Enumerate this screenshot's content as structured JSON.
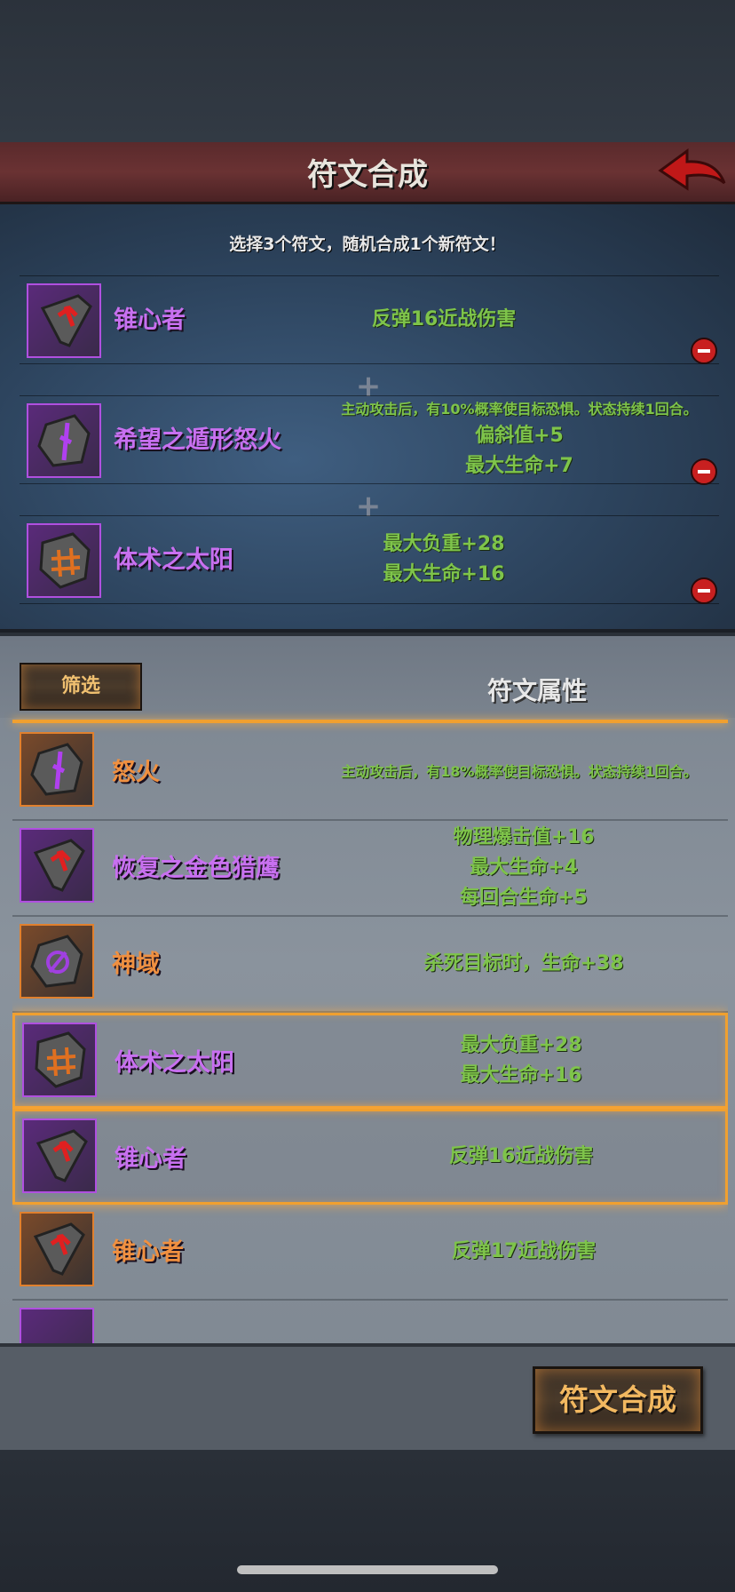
{
  "header": {
    "title": "符文合成",
    "back_icon": "back-arrow-icon"
  },
  "compose": {
    "subtitle": "选择3个符文，随机合成1个新符文！",
    "slots": [
      {
        "name": "锥心者",
        "attrs": [
          "反弹16近战伤害"
        ],
        "icon": "rune-heart-piercer-icon"
      },
      {
        "name": "希望之遁形怒火",
        "attrs": [
          "主动攻击后，有10%概率使目标恐惧。状态持续1回合。",
          "偏斜值+5",
          "最大生命+7"
        ],
        "icon": "rune-fury-icon"
      },
      {
        "name": "体术之太阳",
        "attrs": [
          "最大负重+28",
          "最大生命+16"
        ],
        "icon": "rune-sun-icon"
      }
    ]
  },
  "list": {
    "filter_label": "筛选",
    "title": "符文属性",
    "rows": [
      {
        "name": "怒火",
        "attrs": [
          "主动攻击后，有18%概率使目标恐惧。状态持续1回合。"
        ],
        "color": "orange",
        "selected": false
      },
      {
        "name": "恢复之金色猎鹰",
        "attrs": [
          "物理爆击值+16",
          "最大生命+4",
          "每回合生命+5"
        ],
        "color": "purple",
        "selected": false
      },
      {
        "name": "神域",
        "attrs": [
          "杀死目标时，生命+38"
        ],
        "color": "orange",
        "selected": false
      },
      {
        "name": "体术之太阳",
        "attrs": [
          "最大负重+28",
          "最大生命+16"
        ],
        "color": "purple",
        "selected": true
      },
      {
        "name": "锥心者",
        "attrs": [
          "反弹16近战伤害"
        ],
        "color": "purple",
        "selected": true
      },
      {
        "name": "锥心者",
        "attrs": [
          "反弹17近战伤害"
        ],
        "color": "orange",
        "selected": false
      }
    ]
  },
  "footer": {
    "synth_label": "符文合成"
  },
  "colors": {
    "attr_green": "#7ec44a",
    "purple_name": "#c870f0",
    "orange_name": "#f09040",
    "header_red": "#6a3233",
    "highlight": "#f0a030"
  }
}
